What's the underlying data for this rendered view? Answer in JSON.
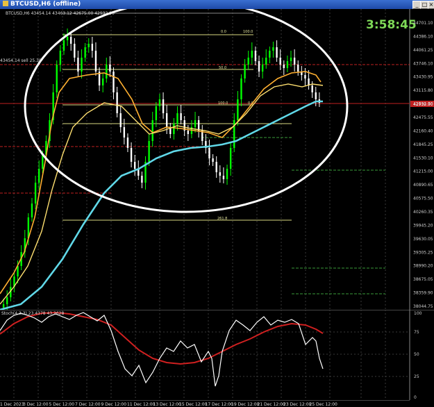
{
  "window": {
    "title": "BTCUSD,H6 (offline)",
    "minimize": "_",
    "restore": "□",
    "close": "×"
  },
  "main": {
    "header": "BTCUSD,H6  43454.14 43463.12 42675.00 42932.90",
    "timer": "3:58:45",
    "current_price": "42932.90",
    "price_labels": [
      "44701.10",
      "44386.10",
      "44061.25",
      "43746.10",
      "43430.95",
      "43115.80",
      "42790.70",
      "42475.55",
      "42160.40",
      "41845.25",
      "41530.10",
      "41215.00",
      "40890.65",
      "40575.50",
      "40260.35",
      "39945.20",
      "39630.05",
      "39305.25",
      "38990.20",
      "38675.05",
      "38359.90",
      "38044.75"
    ],
    "fib_labels": {
      "f0": "0.0",
      "f100_top": "100.0",
      "f50": "50.0",
      "f100_mid": "100.0",
      "f100_mid0": "0.0",
      "f261": "261.8"
    },
    "left_note": "43454.14 sell 25.38"
  },
  "sub": {
    "header": "Stoch(4,3,3) 23.4378 43.2628",
    "levels": [
      "100",
      "75",
      "50",
      "25",
      "0"
    ]
  },
  "xaxis": {
    "labels": [
      "1 Dec 2023",
      "3 Dec 12:00",
      "5 Dec 12:00",
      "7 Dec 12:00",
      "9 Dec 12:00",
      "11 Dec 12:00",
      "13 Dec 12:00",
      "15 Dec 12:00",
      "17 Dec 12:00",
      "19 Dec 12:00",
      "21 Dec 12:00",
      "23 Dec 12:00",
      "25 Dec 12:00"
    ]
  },
  "colors": {
    "bull": "#00ff00",
    "bear": "#ffffff",
    "ema_fast": "#ffb030",
    "ema_mid": "#ffe070",
    "ema_slow": "#60d8e8",
    "stoch_main": "#ffffff",
    "stoch_signal": "#d02020",
    "fib": "#d8d880",
    "sr_red": "#c02020",
    "sr_green": "#3a9a3a",
    "ellipse": "#ffffff"
  }
}
